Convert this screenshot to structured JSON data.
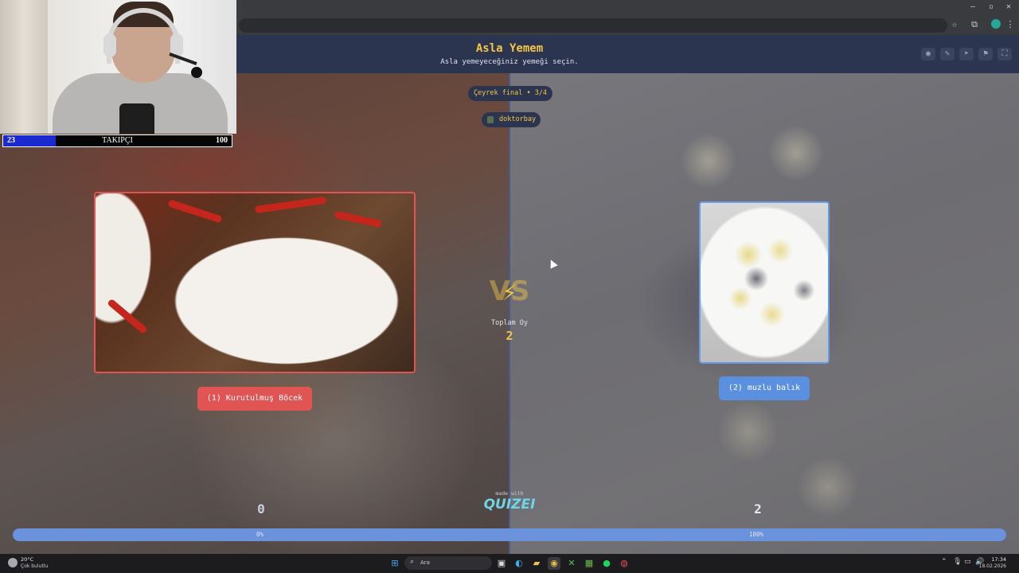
{
  "header": {
    "title": "Asla Yemem",
    "subtitle": "Asla yemeyeceğiniz yemeği seçin."
  },
  "header_icons": [
    "eye-icon",
    "edit-icon",
    "send-icon",
    "flag-icon",
    "fullscreen-icon"
  ],
  "round": "Çeyrek final • 3/4",
  "creator": "doktorbay",
  "left_option": {
    "label": "(1) Kurutulmuş Böcek",
    "votes": "0",
    "percent": "0%",
    "accent": "#e05454"
  },
  "right_option": {
    "label": "(2) muzlu balık",
    "votes": "2",
    "percent": "100%",
    "accent": "#5b8fe0"
  },
  "center": {
    "vs": "VS",
    "total_label": "Toplam Oy",
    "total_value": "2"
  },
  "branding": {
    "made_with": "made with",
    "brand": "QUIZEI"
  },
  "vote_progress": 1.0,
  "stream_overlay": {
    "current": "23",
    "label": "TAKIPÇI",
    "goal": "100",
    "progress": 0.23
  },
  "taskbar": {
    "weather_temp": "20°C",
    "weather_desc": "Çok bulutlu",
    "search_placeholder": "Ara",
    "time": "17:34",
    "date": "18.02.2026"
  },
  "colors": {
    "title": "#f5c542",
    "header_bg": "#2b3550",
    "progress": "#6b93dd"
  }
}
